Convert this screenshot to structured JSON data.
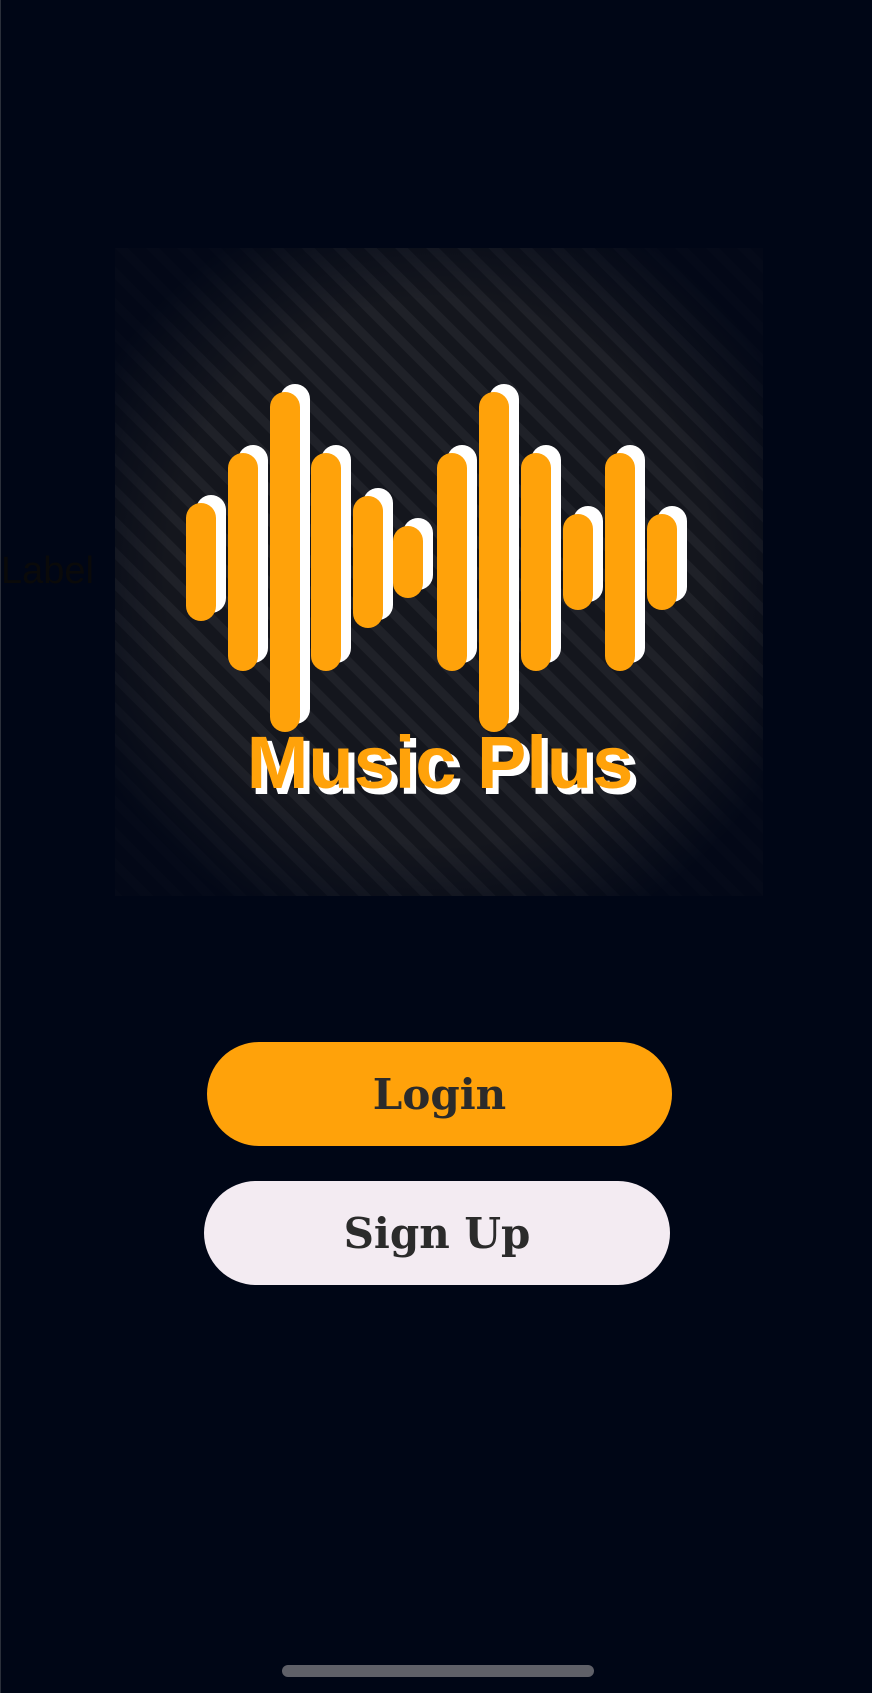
{
  "stray_label": "Label",
  "logo": {
    "brand_text": "Music Plus",
    "icon": "sound-wave-logo",
    "accent_color": "#FFA20A",
    "highlight_color": "#FFFFFF"
  },
  "actions": {
    "login_label": "Login",
    "signup_label": "Sign Up"
  },
  "colors": {
    "background": "#000616",
    "login_button": "#FFA20A",
    "signup_button": "#F3EBF2",
    "button_text": "#2B2B2B"
  }
}
